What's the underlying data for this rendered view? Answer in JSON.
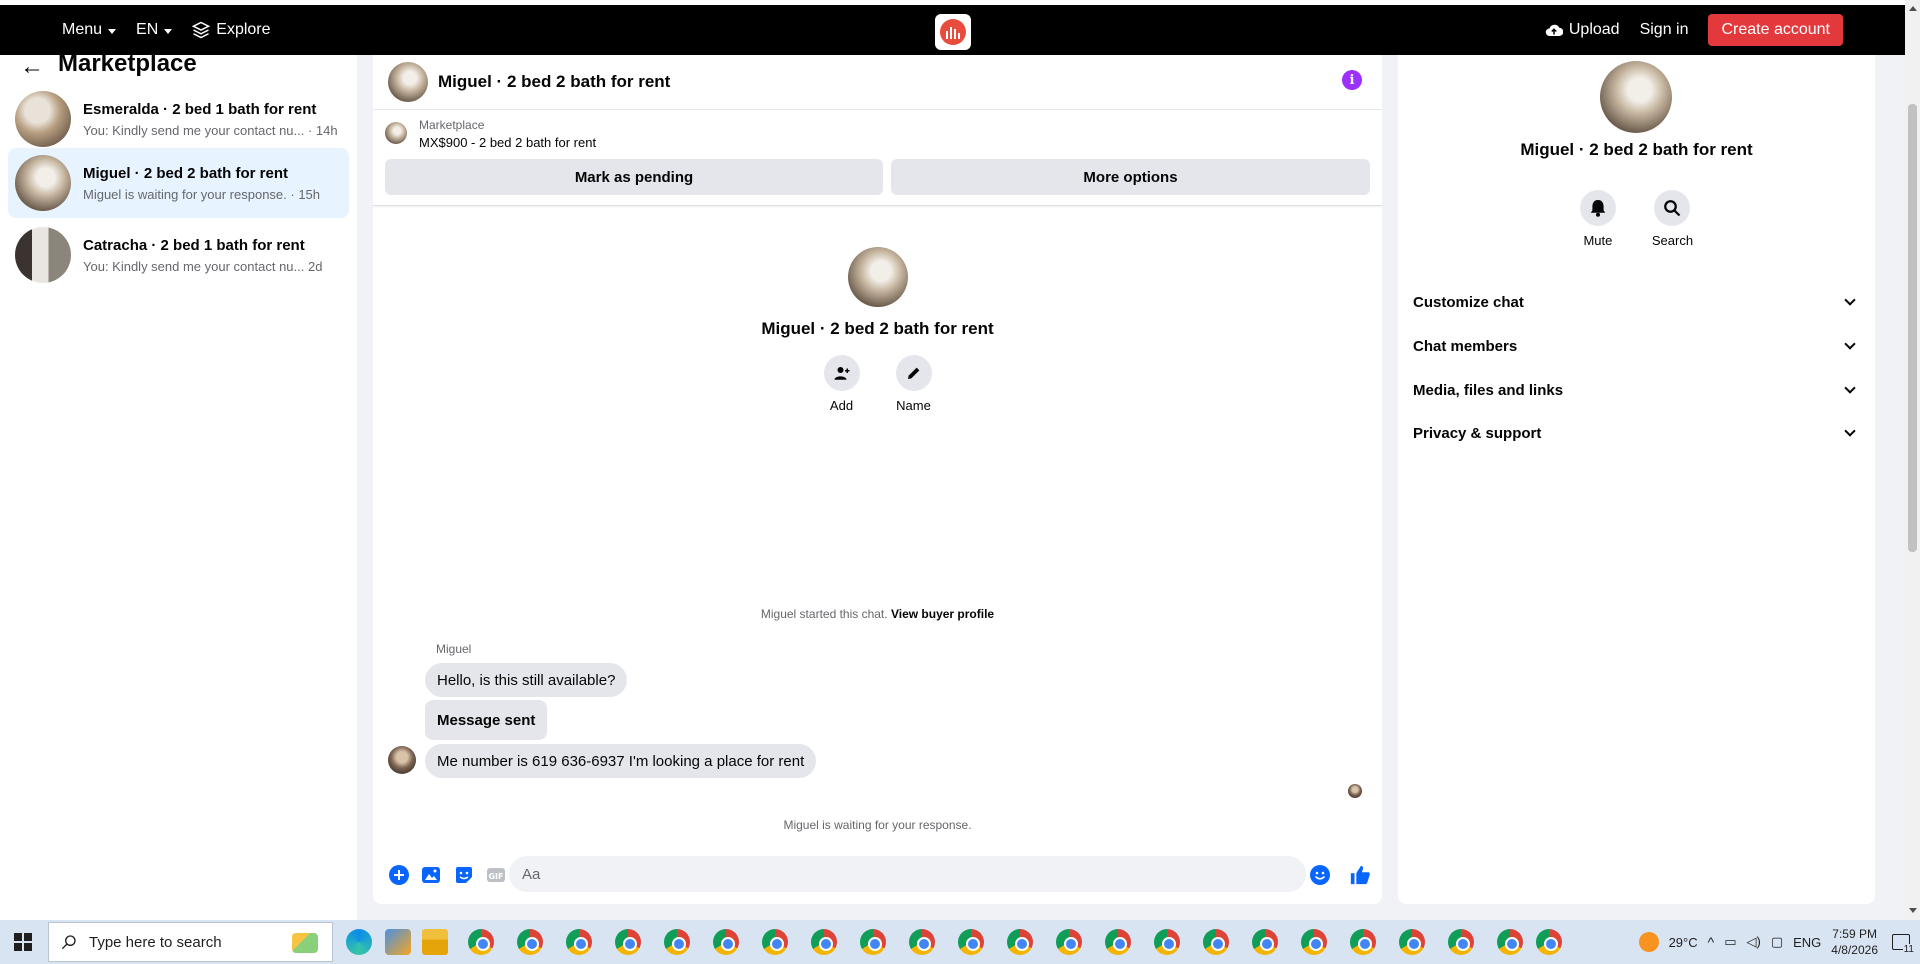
{
  "topbar": {
    "menu_label": "Menu",
    "lang_label": "EN",
    "explore_label": "Explore",
    "upload_label": "Upload",
    "signin_label": "Sign in",
    "create_account_label": "Create account"
  },
  "sidebar": {
    "title": "Marketplace",
    "conversations": [
      {
        "name": "Esmeralda · 2 bed 1 bath for rent",
        "preview": "You: Kindly send me your contact nu... · 14h"
      },
      {
        "name": "Miguel · 2 bed 2 bath for rent",
        "preview": "Miguel is waiting for your response. · 15h"
      },
      {
        "name": "Catracha · 2 bed 1 bath for rent",
        "preview": "You: Kindly send me your contact nu...   2d"
      }
    ]
  },
  "chat": {
    "header_name": "Miguel · 2 bed 2 bath for rent",
    "listing_label": "Marketplace",
    "listing_title": "MX$900 - 2 bed 2 bath for rent",
    "mark_pending_label": "Mark as pending",
    "more_options_label": "More options",
    "intro_name": "Miguel · 2 bed 2 bath for rent",
    "add_label": "Add",
    "name_label": "Name",
    "started_text": "Miguel started this chat.",
    "view_profile_label": "View buyer profile",
    "sender": "Miguel",
    "messages": [
      {
        "text": "Hello, is this still available?"
      },
      {
        "text": "Message sent"
      },
      {
        "text": "Me number is 619 636-6937 I'm looking a place for rent"
      }
    ],
    "waiting_text": "Miguel is waiting for your response.",
    "composer_placeholder": "Aa"
  },
  "info_panel": {
    "name": "Miguel · 2 bed 2 bath for rent",
    "mute_label": "Mute",
    "search_label": "Search",
    "sections": [
      {
        "label": "Customize chat"
      },
      {
        "label": "Chat members"
      },
      {
        "label": "Media, files and links"
      },
      {
        "label": "Privacy & support"
      }
    ]
  },
  "taskbar": {
    "search_placeholder": "Type here to search",
    "temperature": "29°C",
    "lang": "ENG",
    "time": "7:59 PM",
    "date": "4/8/2026",
    "notification_count": "11"
  },
  "colors": {
    "accent": "#0866ff",
    "create_btn": "#e4393c",
    "active_conv": "#e7f3ff",
    "info_icon": "#9b30ff"
  }
}
